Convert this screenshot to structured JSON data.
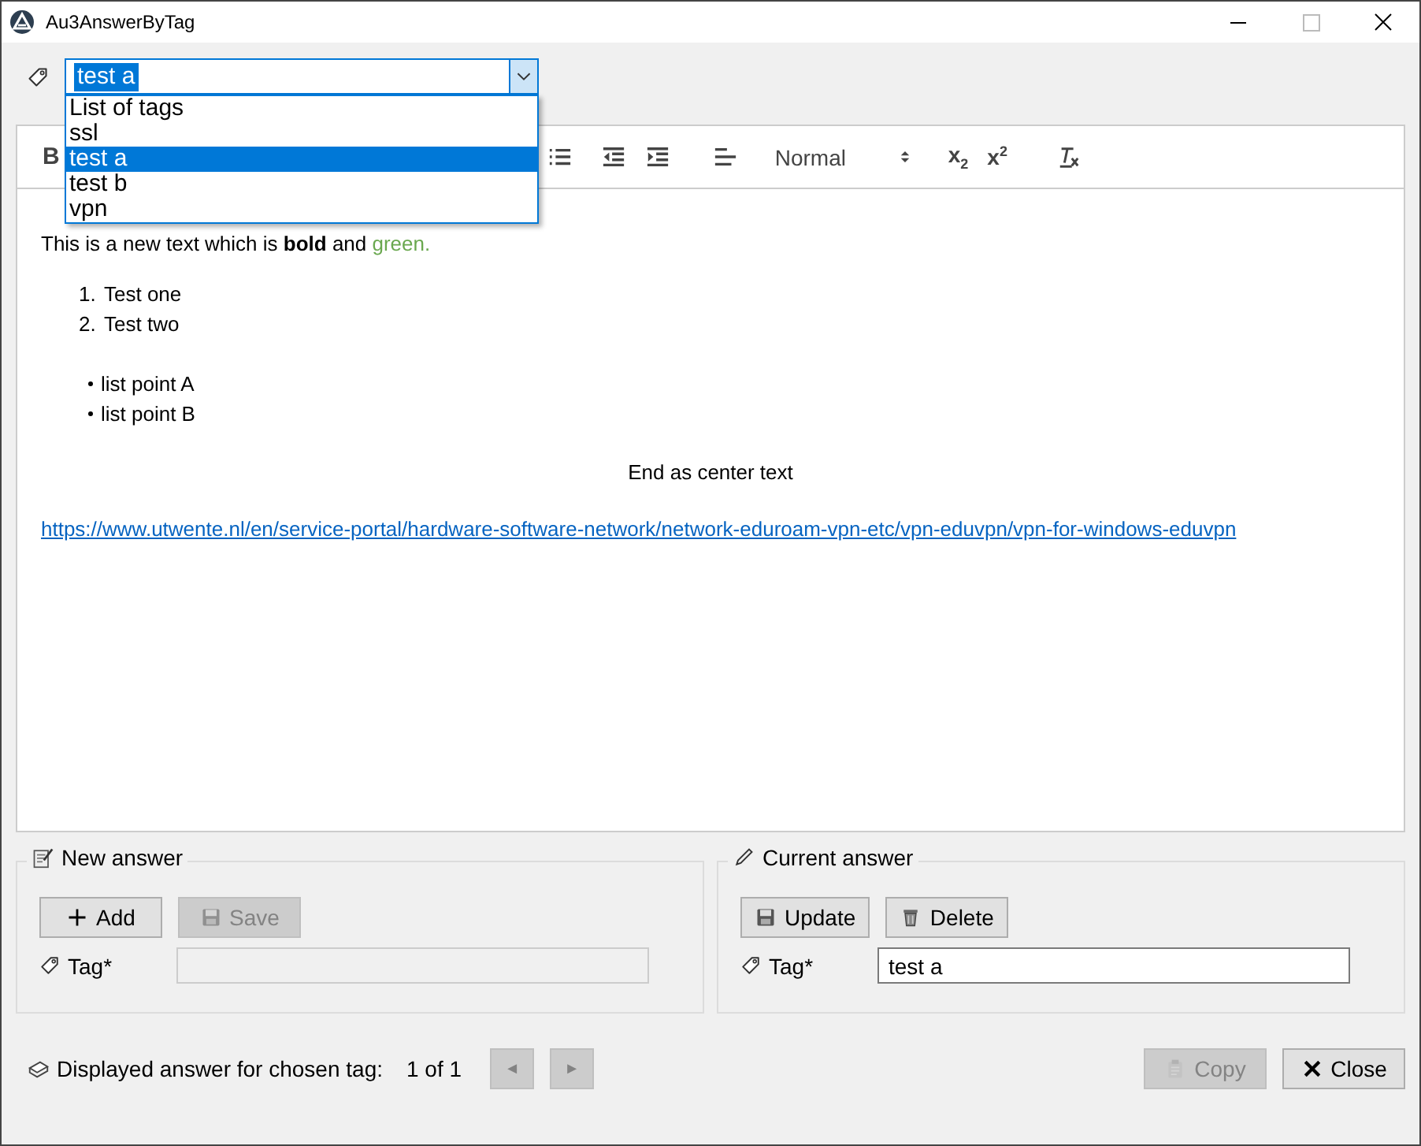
{
  "window": {
    "title": "Au3AnswerByTag"
  },
  "tag_combo": {
    "value": "test a",
    "expanded": true,
    "options": [
      {
        "label": "List of tags",
        "selected": false
      },
      {
        "label": "ssl",
        "selected": false
      },
      {
        "label": "test a",
        "selected": true
      },
      {
        "label": "test b",
        "selected": false
      },
      {
        "label": "vpn",
        "selected": false
      }
    ]
  },
  "editor": {
    "toolbar": [
      {
        "kind": "bold",
        "text": "B"
      },
      {
        "kind": "bullet-list"
      },
      {
        "kind": "outdent"
      },
      {
        "kind": "indent"
      },
      {
        "kind": "align"
      },
      {
        "kind": "header",
        "text": "Normal"
      },
      {
        "kind": "script",
        "text": "x$_{2}$"
      },
      {
        "kind": "script",
        "text": "x$^{2}$"
      },
      {
        "kind": "clean"
      }
    ],
    "content": [
      {
        "kind": "paragraph",
        "runs": [
          {
            "text": "This is a new text which is "
          },
          {
            "text": "bold",
            "bold": true
          },
          {
            "text": " and "
          },
          {
            "text": "green.",
            "color": "#6aa84f"
          }
        ]
      },
      {
        "kind": "ordered",
        "items": [
          {
            "marker": "1.",
            "text": "Test one"
          },
          {
            "marker": "2.",
            "text": "Test two"
          }
        ]
      },
      {
        "kind": "bullets",
        "items": [
          "list point A",
          "list point B"
        ]
      },
      {
        "kind": "center",
        "text": "End as center text"
      },
      {
        "kind": "link",
        "text": "https://www.utwente.nl/en/service-portal/hardware-software-network/network-eduroam-vpn-etc/vpn-eduvpn/vpn-for-windows-eduvpn"
      }
    ]
  },
  "new_answer": {
    "title": "New answer",
    "buttons": [
      {
        "kind": "add",
        "label": "Add",
        "disabled": false
      },
      {
        "kind": "save",
        "label": "Save",
        "disabled": true
      }
    ],
    "tag_label": "Tag*",
    "tag_disabled": true
  },
  "current_answer": {
    "title": "Current answer",
    "buttons": [
      {
        "kind": "save",
        "label": "Update",
        "disabled": false
      },
      {
        "kind": "delete",
        "label": "Delete",
        "disabled": false
      }
    ],
    "tag_label": "Tag*",
    "tag_value": "test a",
    "tag_disabled": false
  },
  "footer": {
    "label": "Displayed answer for chosen tag:",
    "counter": "1 of 1",
    "nav": [
      {
        "label": "◄",
        "disabled": true
      },
      {
        "label": "►",
        "disabled": true
      }
    ],
    "buttons": [
      {
        "kind": "copy",
        "label": "Copy",
        "disabled": true
      },
      {
        "kind": "close",
        "label": "Close",
        "disabled": false
      }
    ]
  }
}
